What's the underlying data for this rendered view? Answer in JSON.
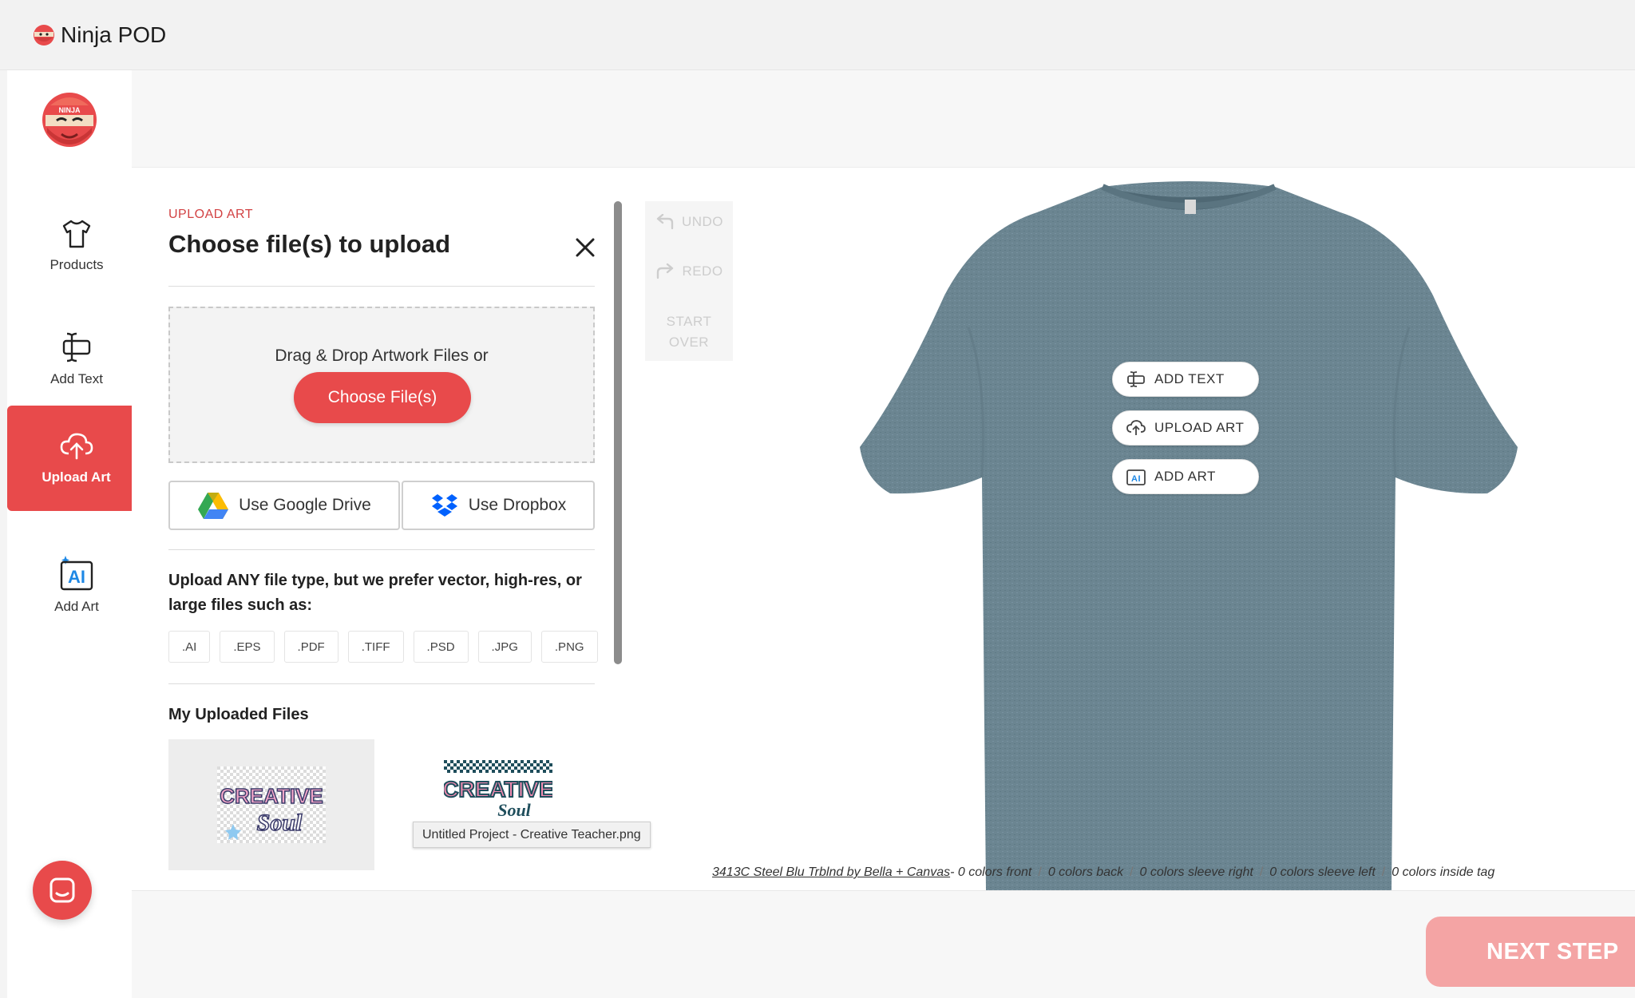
{
  "app": {
    "name": "Ninja POD",
    "nav_logo_text": "NINJA"
  },
  "sidebar": {
    "items": [
      {
        "label": "Products",
        "icon": "tshirt-icon"
      },
      {
        "label": "Add Text",
        "icon": "text-cursor-icon"
      },
      {
        "label": "Upload Art",
        "icon": "cloud-upload-icon",
        "active": true
      },
      {
        "label": "Add Art",
        "icon": "ai-sparkle-icon"
      }
    ],
    "chat_icon": "chat-icon"
  },
  "upload_panel": {
    "eyebrow": "UPLOAD ART",
    "title": "Choose file(s) to upload",
    "dropzone_text": "Drag & Drop Artwork Files or",
    "choose_button": "Choose File(s)",
    "google_drive_button": "Use Google Drive",
    "dropbox_button": "Use Dropbox",
    "prefer_text": "Upload ANY file type, but we prefer vector, high-res, or large files such as:",
    "file_types": [
      ".AI",
      ".EPS",
      ".PDF",
      ".TIFF",
      ".PSD",
      ".JPG",
      ".PNG"
    ],
    "uploaded_title": "My Uploaded Files",
    "uploaded_files": [
      {
        "art_line1": "CREATIVE",
        "art_line2": "Soul"
      },
      {
        "art_line1": "CREATIVE",
        "art_line2": "Soul",
        "tooltip": "Untitled Project - Creative Teacher.png"
      }
    ]
  },
  "history": {
    "undo": "UNDO",
    "redo": "REDO",
    "start_over_line1": "START",
    "start_over_line2": "OVER"
  },
  "canvas": {
    "shirt_color": "#6b8591",
    "quick_actions": [
      "ADD TEXT",
      "UPLOAD ART",
      "ADD ART"
    ]
  },
  "product_info": {
    "product_link": "3413C Steel Blu Trblnd by Bella + Canvas",
    "details": [
      "- 0 colors front",
      "0 colors back",
      "0 colors sleeve right",
      "0 colors sleeve left",
      "0 colors inside tag"
    ]
  },
  "footer": {
    "next_button": "NEXT STEP"
  },
  "colors": {
    "accent": "#e84a4b",
    "next_step_disabled": "#f4a4a4"
  }
}
